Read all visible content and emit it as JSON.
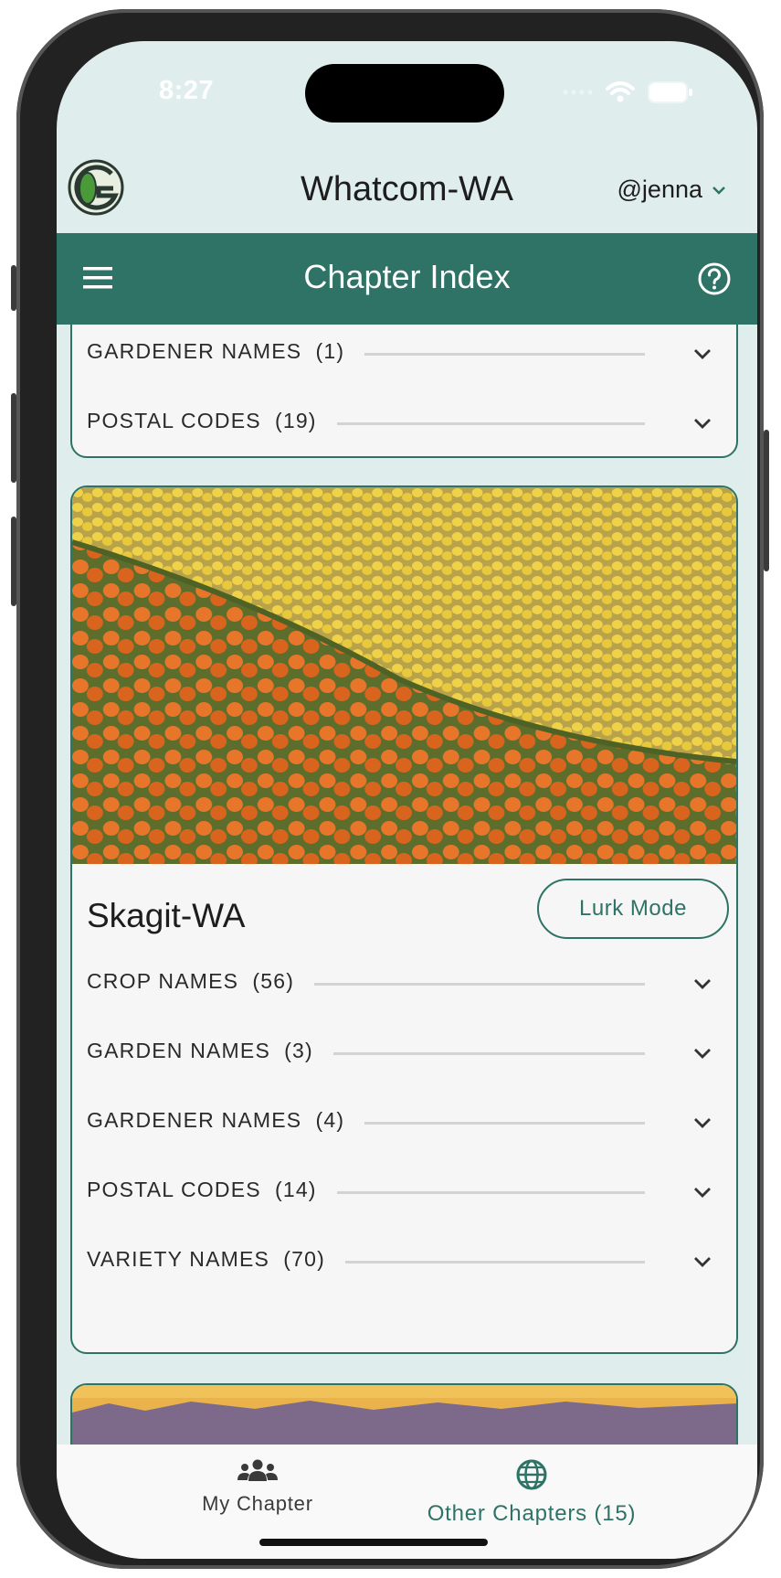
{
  "status_bar": {
    "time": "8:27"
  },
  "header": {
    "chapter_name": "Whatcom-WA",
    "username": "@jenna"
  },
  "toolbar": {
    "title": "Chapter Index"
  },
  "top_card": {
    "rows": [
      {
        "label": "GARDENER NAMES",
        "count": "(1)"
      },
      {
        "label": "POSTAL CODES",
        "count": "(19)"
      }
    ]
  },
  "skagit_card": {
    "title": "Skagit-WA",
    "lurk_button": "Lurk Mode",
    "rows": [
      {
        "label": "CROP NAMES",
        "count": "(56)"
      },
      {
        "label": "GARDEN NAMES",
        "count": "(3)"
      },
      {
        "label": "GARDENER NAMES",
        "count": "(4)"
      },
      {
        "label": "POSTAL CODES",
        "count": "(14)"
      },
      {
        "label": "VARIETY NAMES",
        "count": "(70)"
      }
    ]
  },
  "bottom_nav": {
    "my_chapter": "My Chapter",
    "other_chapters": "Other Chapters (15)"
  },
  "colors": {
    "brand_green": "#2e7366",
    "background": "#dfeeed",
    "card": "#f6f6f6"
  },
  "icons": [
    "logo-icon",
    "chevron-down-icon",
    "menu-icon",
    "help-icon",
    "people-icon",
    "globe-icon",
    "wifi-icon",
    "battery-icon"
  ]
}
